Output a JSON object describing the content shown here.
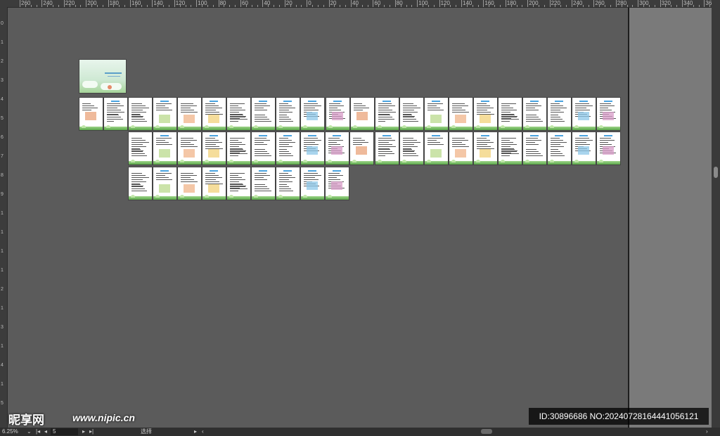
{
  "ruler": {
    "top_labels": [
      "260",
      "240",
      "220",
      "200",
      "180",
      "160",
      "140",
      "120",
      "100",
      "80",
      "60",
      "40",
      "20",
      "0",
      "20",
      "40",
      "60",
      "80",
      "100",
      "120",
      "140",
      "160",
      "180",
      "200",
      "220",
      "240",
      "260",
      "280",
      "300",
      "320",
      "340",
      "360"
    ],
    "left_labels": [
      "0",
      "1",
      "2",
      "3",
      "4",
      "5",
      "6",
      "7",
      "8",
      "9",
      "1",
      "1",
      "1",
      "1",
      "2",
      "1",
      "3",
      "1",
      "4",
      "1",
      "5"
    ]
  },
  "status": {
    "zoom": "6.25%",
    "page_number": "5",
    "first_icon": "first-page-icon",
    "prev_icon": "prev-page-icon",
    "next_icon": "next-page-icon",
    "last_icon": "last-page-icon",
    "status_text": "选择"
  },
  "watermark": {
    "logo": "昵享网",
    "url": "www.nipic.cn",
    "id_text": "ID:30896686 NO:20240728164441056121"
  },
  "colors": {
    "page_footer_green": "#5aa84a",
    "heading_blue": "#4aa3df",
    "canvas_gray": "#5b5b5b",
    "pasteboard_gray": "#7a7a7a"
  }
}
